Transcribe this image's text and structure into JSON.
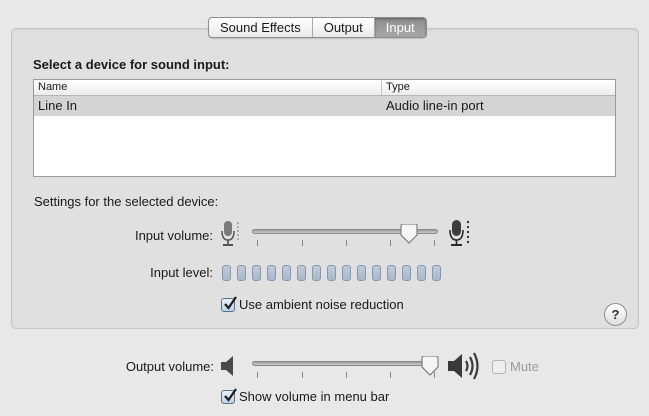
{
  "tabs": [
    {
      "label": "Sound Effects",
      "active": false
    },
    {
      "label": "Output",
      "active": false
    },
    {
      "label": "Input",
      "active": true
    }
  ],
  "device_section": {
    "title": "Select a device for sound input:",
    "columns": [
      "Name",
      "Type"
    ],
    "rows": [
      {
        "name": "Line In",
        "type": "Audio line-in port",
        "selected": true
      }
    ]
  },
  "settings": {
    "title": "Settings for the selected device:",
    "input_volume_label": "Input volume:",
    "input_volume_value": 0.86,
    "input_level_label": "Input level:",
    "input_level_lit": 0,
    "input_level_segments": 15,
    "noise_reduction_label": "Use ambient noise reduction",
    "noise_reduction_checked": true
  },
  "help_label": "?",
  "output": {
    "volume_label": "Output volume:",
    "volume_value": 0.98,
    "mute_label": "Mute",
    "mute_checked": false,
    "mute_enabled": false,
    "menu_bar_label": "Show volume in menu bar",
    "menu_bar_checked": true
  },
  "icons": {
    "mic_low": "microphone-low-icon",
    "mic_high": "microphone-high-icon",
    "speaker_low": "speaker-low-icon",
    "speaker_high": "speaker-high-icon"
  }
}
